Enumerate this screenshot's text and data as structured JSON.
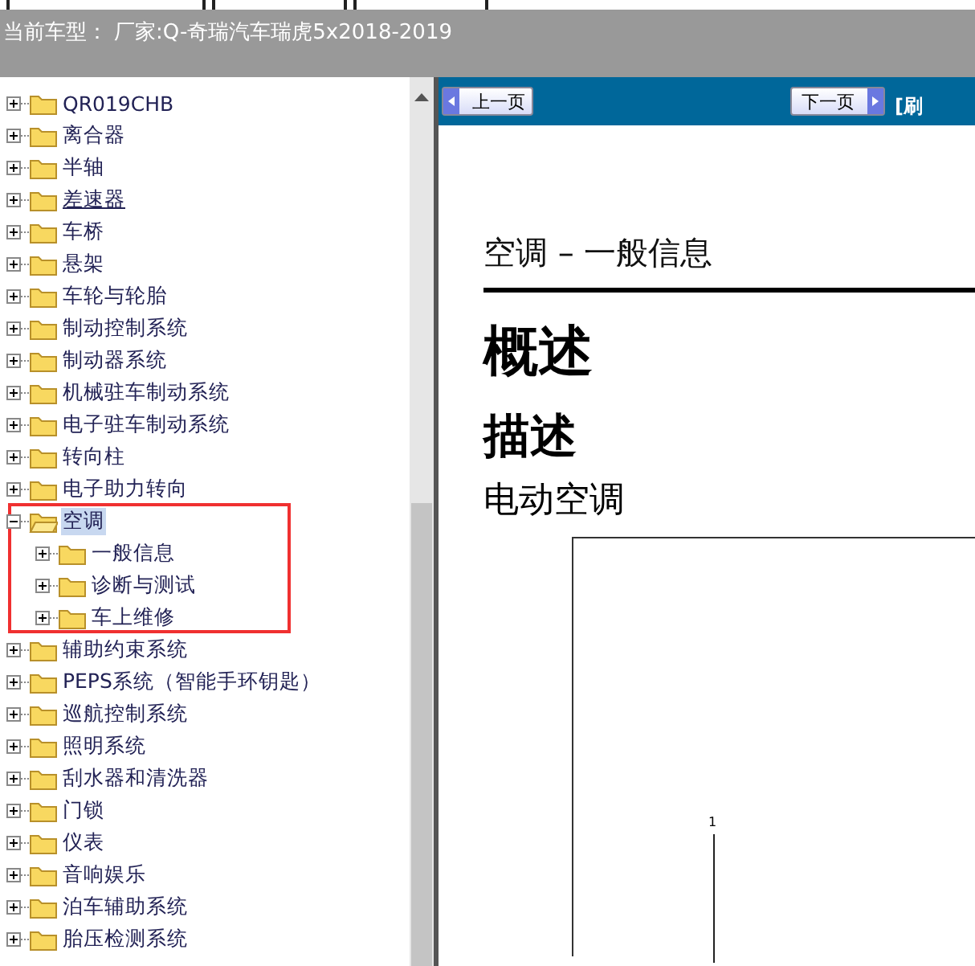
{
  "vehicle_label": "当前车型：",
  "vehicle_value": "厂家:Q-奇瑞汽车瑞虎5x2018-2019",
  "tree": [
    {
      "label": "QR019CHB",
      "expanded": false,
      "selected": false,
      "hovered": false
    },
    {
      "label": "离合器",
      "expanded": false,
      "selected": false,
      "hovered": false
    },
    {
      "label": "半轴",
      "expanded": false,
      "selected": false,
      "hovered": false
    },
    {
      "label": "差速器",
      "expanded": false,
      "selected": false,
      "hovered": true
    },
    {
      "label": "车桥",
      "expanded": false,
      "selected": false,
      "hovered": false
    },
    {
      "label": "悬架",
      "expanded": false,
      "selected": false,
      "hovered": false
    },
    {
      "label": "车轮与轮胎",
      "expanded": false,
      "selected": false,
      "hovered": false
    },
    {
      "label": "制动控制系统",
      "expanded": false,
      "selected": false,
      "hovered": false
    },
    {
      "label": "制动器系统",
      "expanded": false,
      "selected": false,
      "hovered": false
    },
    {
      "label": "机械驻车制动系统",
      "expanded": false,
      "selected": false,
      "hovered": false
    },
    {
      "label": "电子驻车制动系统",
      "expanded": false,
      "selected": false,
      "hovered": false
    },
    {
      "label": "转向柱",
      "expanded": false,
      "selected": false,
      "hovered": false
    },
    {
      "label": "电子助力转向",
      "expanded": false,
      "selected": false,
      "hovered": false
    },
    {
      "label": "空调",
      "expanded": true,
      "selected": true,
      "hovered": false,
      "highlighted": true,
      "children": [
        {
          "label": "一般信息",
          "expanded": false,
          "selected": false,
          "hovered": false
        },
        {
          "label": "诊断与测试",
          "expanded": false,
          "selected": false,
          "hovered": false
        },
        {
          "label": "车上维修",
          "expanded": false,
          "selected": false,
          "hovered": false
        }
      ]
    },
    {
      "label": "辅助约束系统",
      "expanded": false,
      "selected": false,
      "hovered": false
    },
    {
      "label": "PEPS系统（智能手环钥匙）",
      "expanded": false,
      "selected": false,
      "hovered": false
    },
    {
      "label": "巡航控制系统",
      "expanded": false,
      "selected": false,
      "hovered": false
    },
    {
      "label": "照明系统",
      "expanded": false,
      "selected": false,
      "hovered": false
    },
    {
      "label": "刮水器和清洗器",
      "expanded": false,
      "selected": false,
      "hovered": false
    },
    {
      "label": "门锁",
      "expanded": false,
      "selected": false,
      "hovered": false
    },
    {
      "label": "仪表",
      "expanded": false,
      "selected": false,
      "hovered": false
    },
    {
      "label": "音响娱乐",
      "expanded": false,
      "selected": false,
      "hovered": false
    },
    {
      "label": "泊车辅助系统",
      "expanded": false,
      "selected": false,
      "hovered": false
    },
    {
      "label": "胎压检测系统",
      "expanded": false,
      "selected": false,
      "hovered": false
    }
  ],
  "toolbar": {
    "prev": "上一页",
    "next": "下一页",
    "refresh": "[刷"
  },
  "document": {
    "header": "空调 – 一般信息",
    "h1": "概述",
    "h2": "描述",
    "h3": "电动空调",
    "callout": "1"
  }
}
